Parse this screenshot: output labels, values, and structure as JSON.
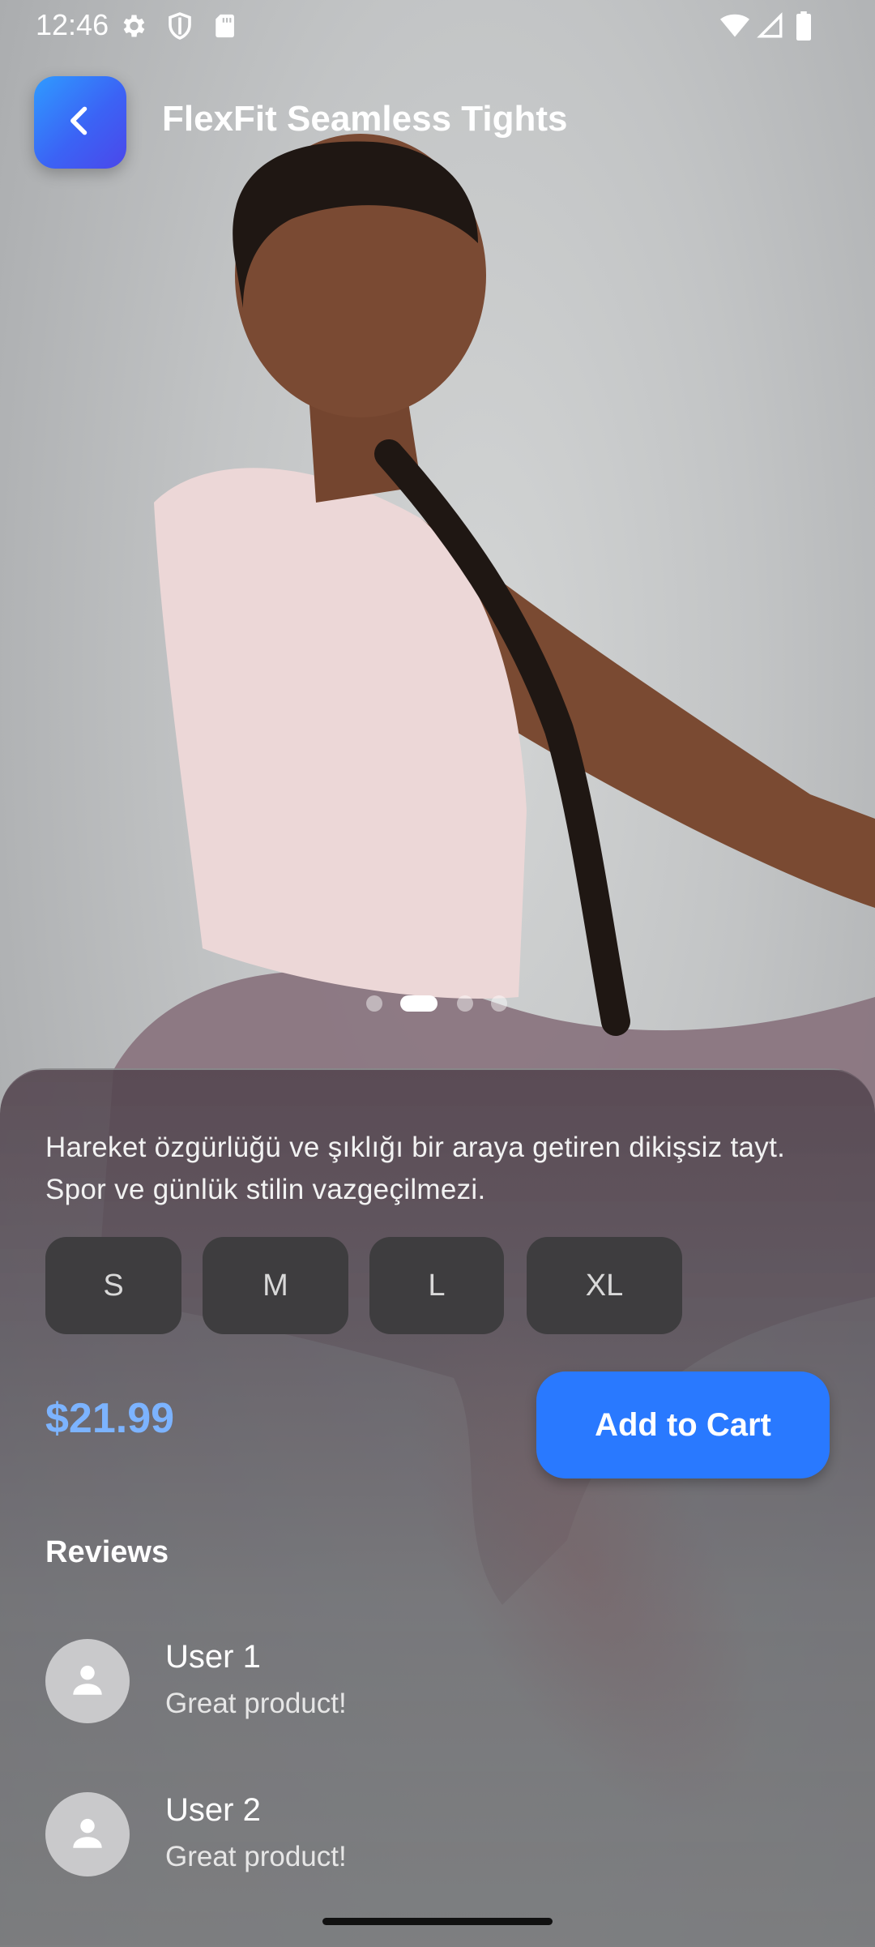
{
  "status_bar": {
    "time": "12:46"
  },
  "app_bar": {
    "title": "FlexFit Seamless Tights"
  },
  "carousel": {
    "total": 4,
    "active_index": 1
  },
  "product": {
    "description": "Hareket özgürlüğü ve şıklığı bir araya getiren dikişsiz tayt. Spor ve günlük stilin vazgeçilmezi.",
    "sizes": [
      "S",
      "M",
      "L",
      "XL"
    ],
    "price": "$21.99",
    "add_to_cart_label": "Add to Cart"
  },
  "reviews": {
    "title": "Reviews",
    "items": [
      {
        "user": "User 1",
        "text": "Great product!"
      },
      {
        "user": "User 2",
        "text": "Great product!"
      }
    ]
  },
  "colors": {
    "accent": "#2979ff",
    "price": "#7cb3ff",
    "back_button_gradient": [
      "#2f9bff",
      "#4b47ea"
    ]
  }
}
